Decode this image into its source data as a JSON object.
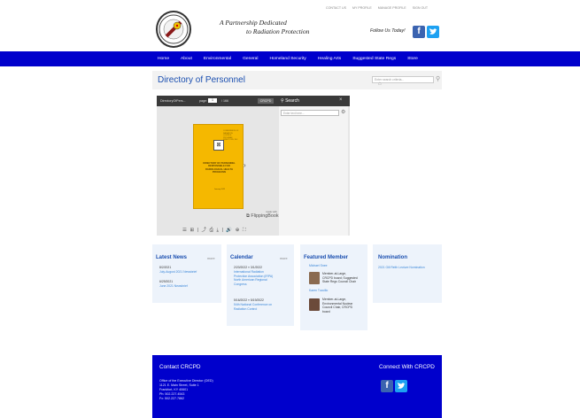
{
  "header": {
    "tagline_line1": "A Partnership Dedicated",
    "tagline_line2": "to Radiation Protection",
    "top_links": [
      "CONTACT US",
      "MY PROFILE",
      "MANAGE PROFILE",
      "SIGN OUT"
    ],
    "follow_text": "Follow Us Today!",
    "social": {
      "facebook": "f",
      "twitter": "t"
    }
  },
  "nav": {
    "items": [
      "Home",
      "About",
      "Environmental",
      "General",
      "Homeland Security",
      "Healing Arts",
      "Suggested State Regs",
      "Store"
    ]
  },
  "page": {
    "title": "Directory of Personnel",
    "search_placeholder": "Enter search criteria..."
  },
  "flipbook": {
    "title": "DirectoryOfPers...",
    "page_label": "page:",
    "page_value": "1",
    "page_total": "/ 166",
    "tag": "CRCPD",
    "search_label": "Search",
    "search_placeholder": "Enter text here...",
    "book_header": "CONFERENCE OF RADIATION CONTROL PROGRAM DIRECTORS, INC.",
    "book_title": "DIRECTORY OF PERSONNEL RESPONSIBLE FOR RADIOLOGICAL HEALTH PROGRAMS",
    "book_date": "January 2022",
    "made_with": "made with",
    "brand": "⧉ FlippingBook",
    "controls": "☰ ⊞ | ⤴ ⎙ ⤓ | 🔊 ⊕ ⛶"
  },
  "widgets": {
    "news": {
      "title": "Latest News",
      "more": "more",
      "items": [
        {
          "date": "8/2/2021",
          "link": "July-August 2021 Newsbrief"
        },
        {
          "date": "6/29/2021",
          "link": "June 2021 Newsbrief"
        }
      ]
    },
    "calendar": {
      "title": "Calendar",
      "more": "more",
      "events": [
        {
          "date": "2/20/2022 » 3/1/2022",
          "lines": [
            "International Radiation",
            "Protection Association (IRPA)",
            "North American Regional",
            "Congress"
          ]
        },
        {
          "date": "5/16/2022 » 5/19/2022",
          "lines": [
            "54th National Conference on",
            "Radiation Control"
          ]
        }
      ]
    },
    "featured": {
      "title": "Featured Member",
      "members": [
        {
          "name": "Michael Snee",
          "desc": [
            "Member-at-Large,",
            "CRCPD board; Suggested",
            "State Regs Council Chair"
          ]
        },
        {
          "name": "Karen Tuccillo",
          "desc": [
            "Member-at-Large,",
            "Environmental Nuclear",
            "Council Chair, CRCPD",
            "board"
          ]
        }
      ]
    },
    "nomination": {
      "title": "Nomination",
      "link": "2021 Gill Reith Lecture Nomination"
    }
  },
  "footer": {
    "contact_title": "Contact CRCPD",
    "connect_title": "Connect With CRCPD",
    "address": [
      "Office of the Executive Director (OED)",
      "1121 E. Main Street, Suite 1",
      "Frankfort, KY 40601",
      "Ph: 502.227.4543",
      "Fx: 502.227.7862"
    ]
  },
  "colors": {
    "nav_blue": "#0000cc",
    "link_blue": "#3a86d8",
    "title_blue": "#1b4fb0",
    "book_yellow": "#f5b800"
  }
}
